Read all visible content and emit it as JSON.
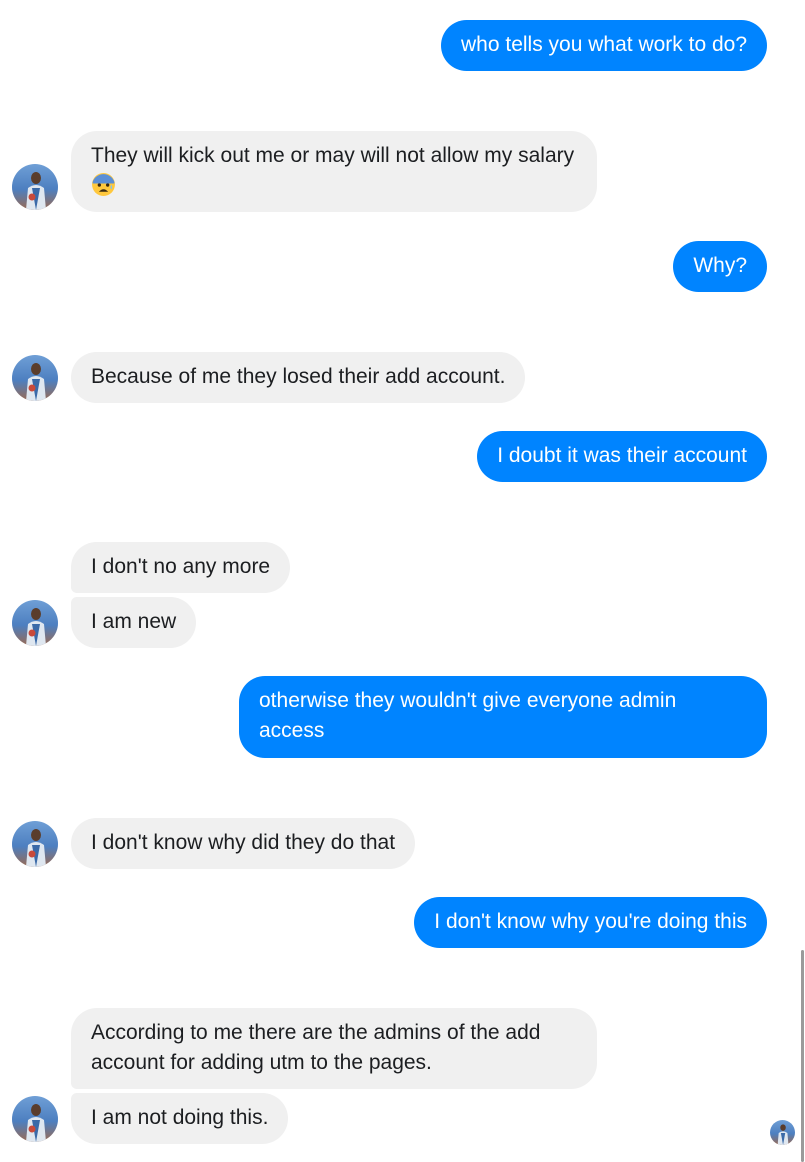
{
  "messages": [
    {
      "sender": "me",
      "text": "who tells you what work to do?"
    },
    {
      "sender": "them",
      "text": "They will kick out me or may will not allow my salary",
      "emoji": "anxious-face-with-sweat"
    },
    {
      "sender": "me",
      "text": "Why?"
    },
    {
      "sender": "them",
      "text": "Because of me they losed their add account."
    },
    {
      "sender": "me",
      "text": "I doubt it was their account"
    },
    {
      "sender": "them",
      "text": "I don't no any more"
    },
    {
      "sender": "them",
      "text": "I am new"
    },
    {
      "sender": "me",
      "text": "otherwise they wouldn't give everyone admin access"
    },
    {
      "sender": "them",
      "text": "I don't know why did they do that"
    },
    {
      "sender": "me",
      "text": "I don't know why you're doing this"
    },
    {
      "sender": "them",
      "text": "According to me there are the admins of the add account for adding utm to the pages."
    },
    {
      "sender": "them",
      "text": "I am not doing this."
    }
  ],
  "colors": {
    "outgoing_bubble": "#0084ff",
    "incoming_bubble": "#f0f0f0",
    "outgoing_text": "#ffffff",
    "incoming_text": "#1c1e21"
  },
  "icons": {
    "avatar": "contact-avatar-icon",
    "read_receipt": "seen-avatar-icon",
    "emoji": "anxious-face-with-sweat-emoji-icon"
  }
}
